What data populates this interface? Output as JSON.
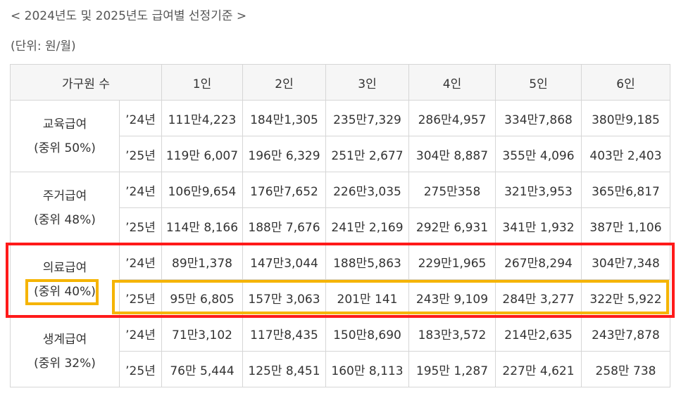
{
  "title": "< 2024년도 및 2025년도 급여별 선정기준 >",
  "unit": "(단위: 원/월)",
  "header": [
    "가구원 수",
    "1인",
    "2인",
    "3인",
    "4인",
    "5인",
    "6인"
  ],
  "groups": [
    {
      "name": "교육급여",
      "sub": "(중위 50%)",
      "rows": [
        {
          "year": "’24년",
          "values": [
            "111만4,223",
            "184만1,305",
            "235만7,329",
            "286만4,957",
            "334만7,868",
            "380만9,185"
          ]
        },
        {
          "year": "’25년",
          "values": [
            "119만 6,007",
            "196만 6,329",
            "251만 2,677",
            "304만 8,887",
            "355만 4,096",
            "403만 2,403"
          ]
        }
      ]
    },
    {
      "name": "주거급여",
      "sub": "(중위 48%)",
      "rows": [
        {
          "year": "’24년",
          "values": [
            "106만9,654",
            "176만7,652",
            "226만3,035",
            "275만358",
            "321만3,953",
            "365만6,817"
          ]
        },
        {
          "year": "’25년",
          "values": [
            "114만 8,166",
            "188만 7,676",
            "241만 2,169",
            "292만 6,931",
            "341만 1,932",
            "387만 1,106"
          ]
        }
      ]
    },
    {
      "name": "의료급여",
      "sub": "(중위 40%)",
      "rows": [
        {
          "year": "’24년",
          "values": [
            "89만1,378",
            "147만3,044",
            "188만5,863",
            "229만1,965",
            "267만8,294",
            "304만7,348"
          ]
        },
        {
          "year": "’25년",
          "values": [
            "95만 6,805",
            "157만 3,063",
            "201만 141",
            "243만 9,109",
            "284만 3,277",
            "322만 5,922"
          ]
        }
      ]
    },
    {
      "name": "생계급여",
      "sub": "(중위 32%)",
      "rows": [
        {
          "year": "’24년",
          "values": [
            "71만3,102",
            "117만8,435",
            "150만8,690",
            "183만3,572",
            "214만2,635",
            "243만7,878"
          ]
        },
        {
          "year": "’25년",
          "values": [
            "76만 5,444",
            "125만 8,451",
            "160만 8,113",
            "195만 1,287",
            "227만 4,621",
            "258만 738"
          ]
        }
      ]
    }
  ],
  "highlight_colors": {
    "row_box": "#ff1a1a",
    "cell_box": "#f5b400"
  }
}
